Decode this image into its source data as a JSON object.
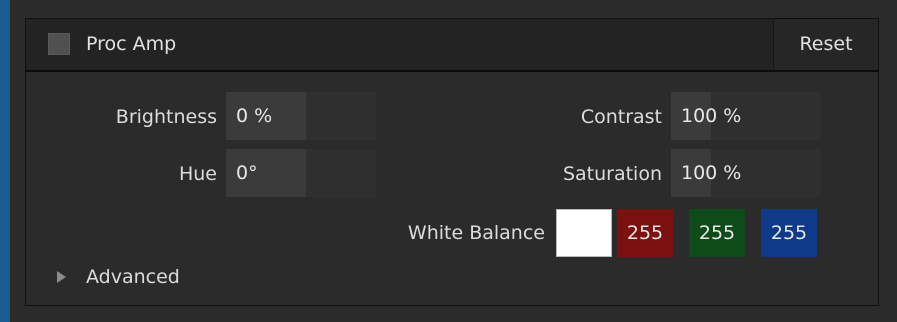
{
  "panel": {
    "title": "Proc Amp",
    "enabled": false,
    "reset_label": "Reset"
  },
  "brightness": {
    "label": "Brightness",
    "value": "0 %"
  },
  "contrast": {
    "label": "Contrast",
    "value": "100 %"
  },
  "hue": {
    "label": "Hue",
    "value": "0°"
  },
  "saturation": {
    "label": "Saturation",
    "value": "100 %"
  },
  "white_balance": {
    "label": "White Balance",
    "swatch_color": "#ffffff",
    "red": "255",
    "green": "255",
    "blue": "255",
    "red_color": "#7a1010",
    "green_color": "#0f4a1a",
    "blue_color": "#0f3a8a"
  },
  "advanced": {
    "label": "Advanced",
    "expanded": false,
    "icon": "triangle-right-icon"
  }
}
